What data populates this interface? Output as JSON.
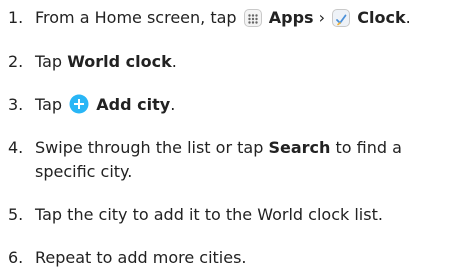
{
  "steps": [
    {
      "num": "1.",
      "pre": "From a Home screen, tap",
      "apps_label": "Apps",
      "sep": "›",
      "clock_label": "Clock",
      "end": "."
    },
    {
      "num": "2.",
      "pre": "Tap",
      "bold": "World clock",
      "end": "."
    },
    {
      "num": "3.",
      "pre": "Tap",
      "bold": "Add city",
      "end": "."
    },
    {
      "num": "4.",
      "pre": "Swipe through the list or tap",
      "bold": "Search",
      "post": "to find a",
      "cont": "specific city."
    },
    {
      "num": "5.",
      "text": "Tap the city to add it to the World clock list."
    },
    {
      "num": "6.",
      "text": "Repeat to add more cities."
    }
  ],
  "colors": {
    "text": "#222222",
    "add_icon": "#29b6f6",
    "clock_hand_primary": "#4a90d9",
    "clock_hand_secondary": "#f2b233"
  }
}
